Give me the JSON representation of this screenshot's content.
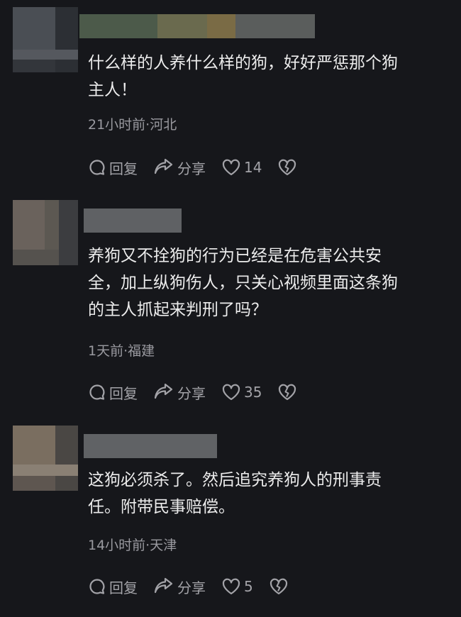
{
  "comments": [
    {
      "text_lines": [
        "什么样的人养什么样的狗，好好严惩那个狗",
        "主人！"
      ],
      "meta": "21小时前·河北",
      "reply_label": "回复",
      "share_label": "分享",
      "likes": "14"
    },
    {
      "text_lines": [
        "养狗又不拴狗的行为已经是在危害公共安",
        "全，加上纵狗伤人，只关心视频里面这条狗",
        "的主人抓起来判刑了吗？"
      ],
      "meta": "1天前·福建",
      "reply_label": "回复",
      "share_label": "分享",
      "likes": "35"
    },
    {
      "text_lines": [
        "这狗必须杀了。然后追究养狗人的刑事责",
        "任。附带民事赔偿。"
      ],
      "meta": "14小时前·天津",
      "reply_label": "回复",
      "share_label": "分享",
      "likes": "5"
    }
  ],
  "icons": [
    "comment-icon",
    "share-arrow-icon",
    "heart-icon",
    "broken-heart-icon"
  ],
  "colors": {
    "background": "#16171b",
    "text": "#ececec",
    "secondary": "#9a9aa0"
  }
}
